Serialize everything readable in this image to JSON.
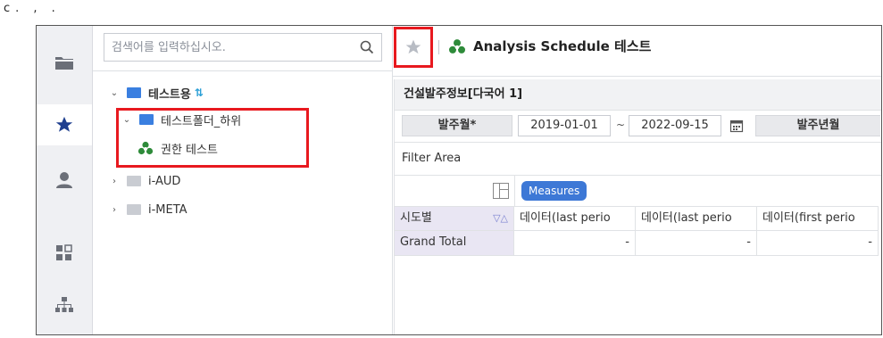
{
  "caption": "c.  ,  .",
  "rail": {
    "items": [
      {
        "icon": "folder-icon"
      },
      {
        "icon": "star-icon",
        "active": true
      },
      {
        "icon": "user-icon"
      },
      {
        "icon": "dashboard-icon"
      },
      {
        "icon": "hierarchy-icon"
      }
    ]
  },
  "search": {
    "placeholder": "검색어를 입력하십시오."
  },
  "tree": {
    "nodes": [
      {
        "label": "테스트용",
        "level": 0,
        "expanded": true,
        "sync": "⇅"
      },
      {
        "label": "테스트폴더_하위",
        "level": 1,
        "expanded": true
      },
      {
        "label": "권한 테스트",
        "level": 2,
        "type": "report"
      },
      {
        "label": "i-AUD",
        "level": 0,
        "expanded": false
      },
      {
        "label": "i-META",
        "level": 0,
        "expanded": false
      }
    ]
  },
  "report": {
    "title": "Analysis Schedule 테스트",
    "sheet_title": "건설발주정보[다국어 1]",
    "params": {
      "label1": "발주월*",
      "from": "2019-01-01",
      "tilde": "~",
      "to": "2022-09-15",
      "label2": "발주년월"
    },
    "filter_area": "Filter Area",
    "measures_label": "Measures",
    "grid": {
      "row_header": "시도별",
      "columns": [
        "데이터(last perio",
        "데이터(last perio",
        "데이터(first perio"
      ],
      "rows": [
        {
          "label": "Grand Total",
          "values": [
            "-",
            "-",
            "-"
          ]
        }
      ]
    }
  },
  "colors": {
    "highlight": "#e8191f",
    "folder": "#3a7fe0",
    "folder_gray": "#c9ccd2",
    "measures": "#3d78d6",
    "report_icon": "#2e8b3a"
  }
}
